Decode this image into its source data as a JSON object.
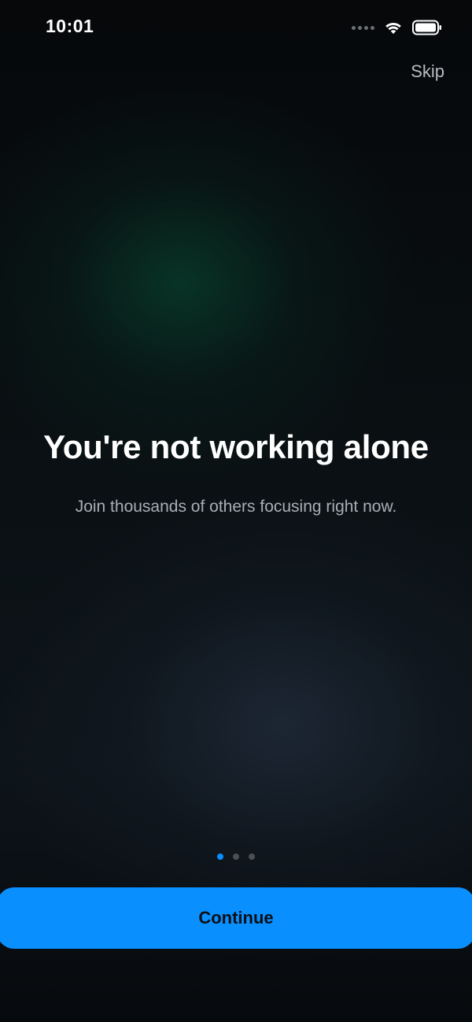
{
  "status_bar": {
    "time": "10:01",
    "icons": [
      "signal-dots-icon",
      "wifi-icon",
      "battery-icon"
    ]
  },
  "header": {
    "skip_label": "Skip"
  },
  "main": {
    "headline": "You're not working alone",
    "subheadline": "Join thousands of others focusing right now."
  },
  "pager": {
    "page_count": 3,
    "current_page": 1
  },
  "footer": {
    "continue_label": "Continue"
  },
  "colors": {
    "accent": "#0a8fff",
    "active_dot": "#0a8dff",
    "inactive_dot": "#4a4f55",
    "subtext": "#a9aeb4",
    "skip_text": "#b8bcc1"
  }
}
